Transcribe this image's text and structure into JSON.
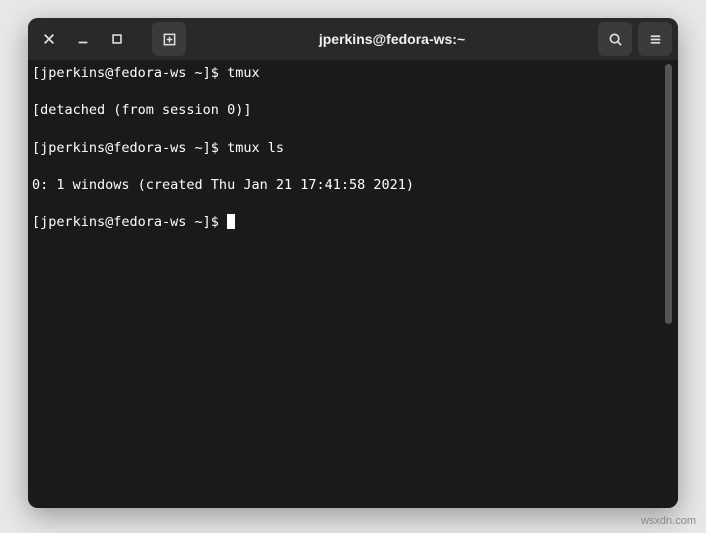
{
  "titlebar": {
    "close_label": "Close",
    "minimize_label": "Minimize",
    "maximize_label": "Maximize",
    "newtab_label": "New Tab",
    "search_label": "Search",
    "menu_label": "Menu",
    "title": "jperkins@fedora-ws:~"
  },
  "terminal": {
    "lines": [
      {
        "prompt": "[jperkins@fedora-ws ~]$ ",
        "cmd": "tmux"
      },
      {
        "text": "[detached (from session 0)]"
      },
      {
        "prompt": "[jperkins@fedora-ws ~]$ ",
        "cmd": "tmux ls"
      },
      {
        "text": "0: 1 windows (created Thu Jan 21 17:41:58 2021)"
      },
      {
        "prompt": "[jperkins@fedora-ws ~]$ ",
        "cursor": true
      }
    ]
  },
  "watermark": "wsxdn.com"
}
